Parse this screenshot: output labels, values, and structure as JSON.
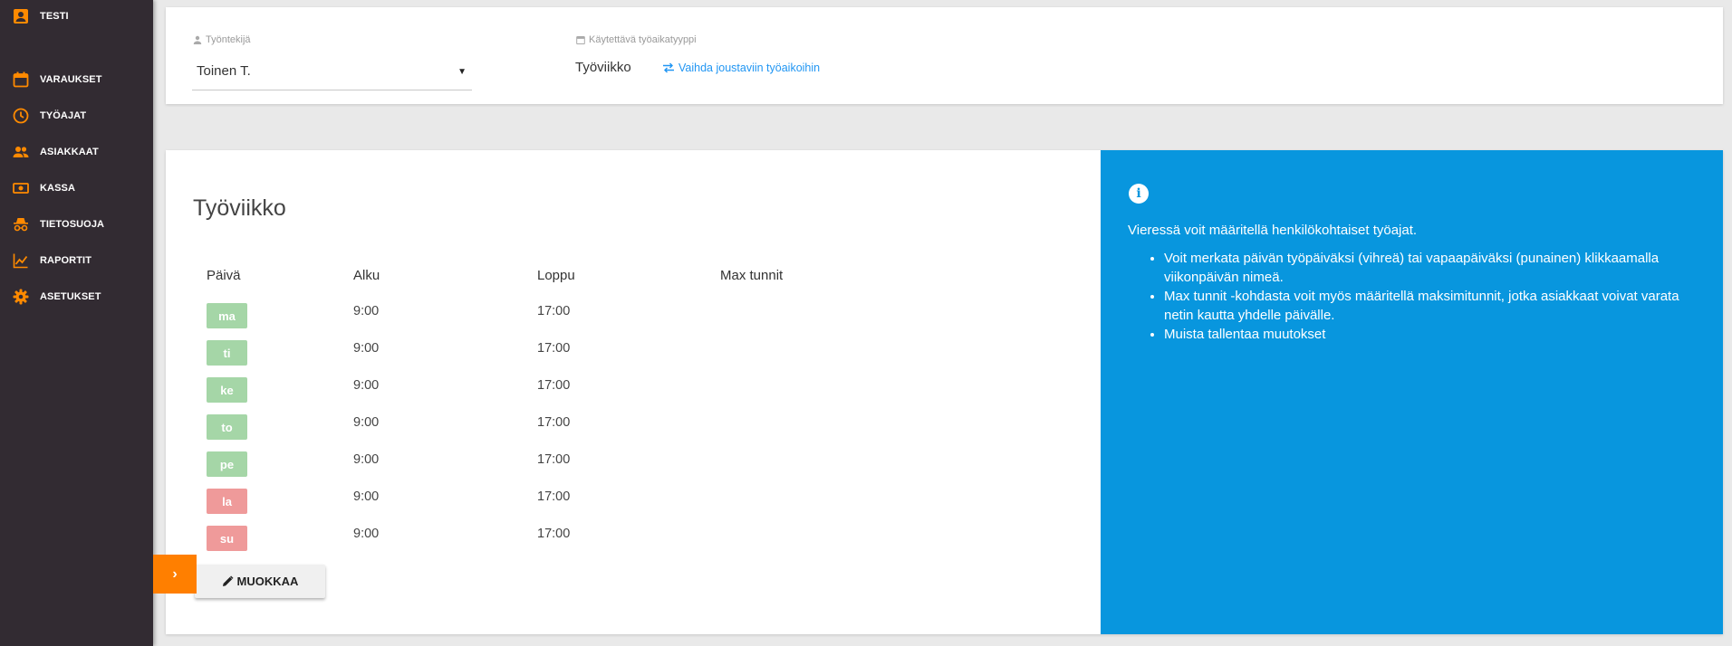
{
  "sidebar": {
    "items": [
      {
        "label": "TESTI",
        "icon": "user-badge-icon"
      },
      {
        "label": "VARAUKSET",
        "icon": "calendar-icon"
      },
      {
        "label": "TYÖAJAT",
        "icon": "clock-icon"
      },
      {
        "label": "ASIAKKAAT",
        "icon": "people-icon"
      },
      {
        "label": "KASSA",
        "icon": "cash-icon"
      },
      {
        "label": "TIETOSUOJA",
        "icon": "incognito-icon"
      },
      {
        "label": "RAPORTIT",
        "icon": "chart-line-icon"
      },
      {
        "label": "ASETUKSET",
        "icon": "gear-icon"
      }
    ],
    "icon_color": "#ff8a00"
  },
  "top": {
    "employee_label": "Työntekijä",
    "employee_value": "Toinen T.",
    "worktype_label": "Käytettävä työaikatyyppi",
    "worktype_value": "Työviikko",
    "switch_link": "Vaihda joustaviin työaikoihin"
  },
  "main": {
    "title": "Työviikko",
    "columns": [
      "Päivä",
      "Alku",
      "Loppu",
      "Max tunnit"
    ],
    "rows": [
      {
        "day": "ma",
        "start": "9:00",
        "end": "17:00",
        "status": "work"
      },
      {
        "day": "ti",
        "start": "9:00",
        "end": "17:00",
        "status": "work"
      },
      {
        "day": "ke",
        "start": "9:00",
        "end": "17:00",
        "status": "work"
      },
      {
        "day": "to",
        "start": "9:00",
        "end": "17:00",
        "status": "work"
      },
      {
        "day": "pe",
        "start": "9:00",
        "end": "17:00",
        "status": "work"
      },
      {
        "day": "la",
        "start": "9:00",
        "end": "17:00",
        "status": "off"
      },
      {
        "day": "su",
        "start": "9:00",
        "end": "17:00",
        "status": "off"
      }
    ],
    "edit_label": "MUOKKAA"
  },
  "info": {
    "intro": "Vieressä voit määritellä henkilökohtaiset työajat.",
    "bullets": [
      "Voit merkata päivän työpäiväksi (vihreä) tai vapaapäiväksi (punainen) klikkaamalla viikonpäivän nimeä.",
      "Max tunnit -kohdasta voit myös määritellä maksimitunnit, jotka asiakkaat voivat varata netin kautta yhdelle päivälle.",
      "Muista tallentaa muutokset"
    ],
    "background": "#0896de"
  },
  "fab": {
    "label": "›",
    "color": "#ff7f00"
  }
}
